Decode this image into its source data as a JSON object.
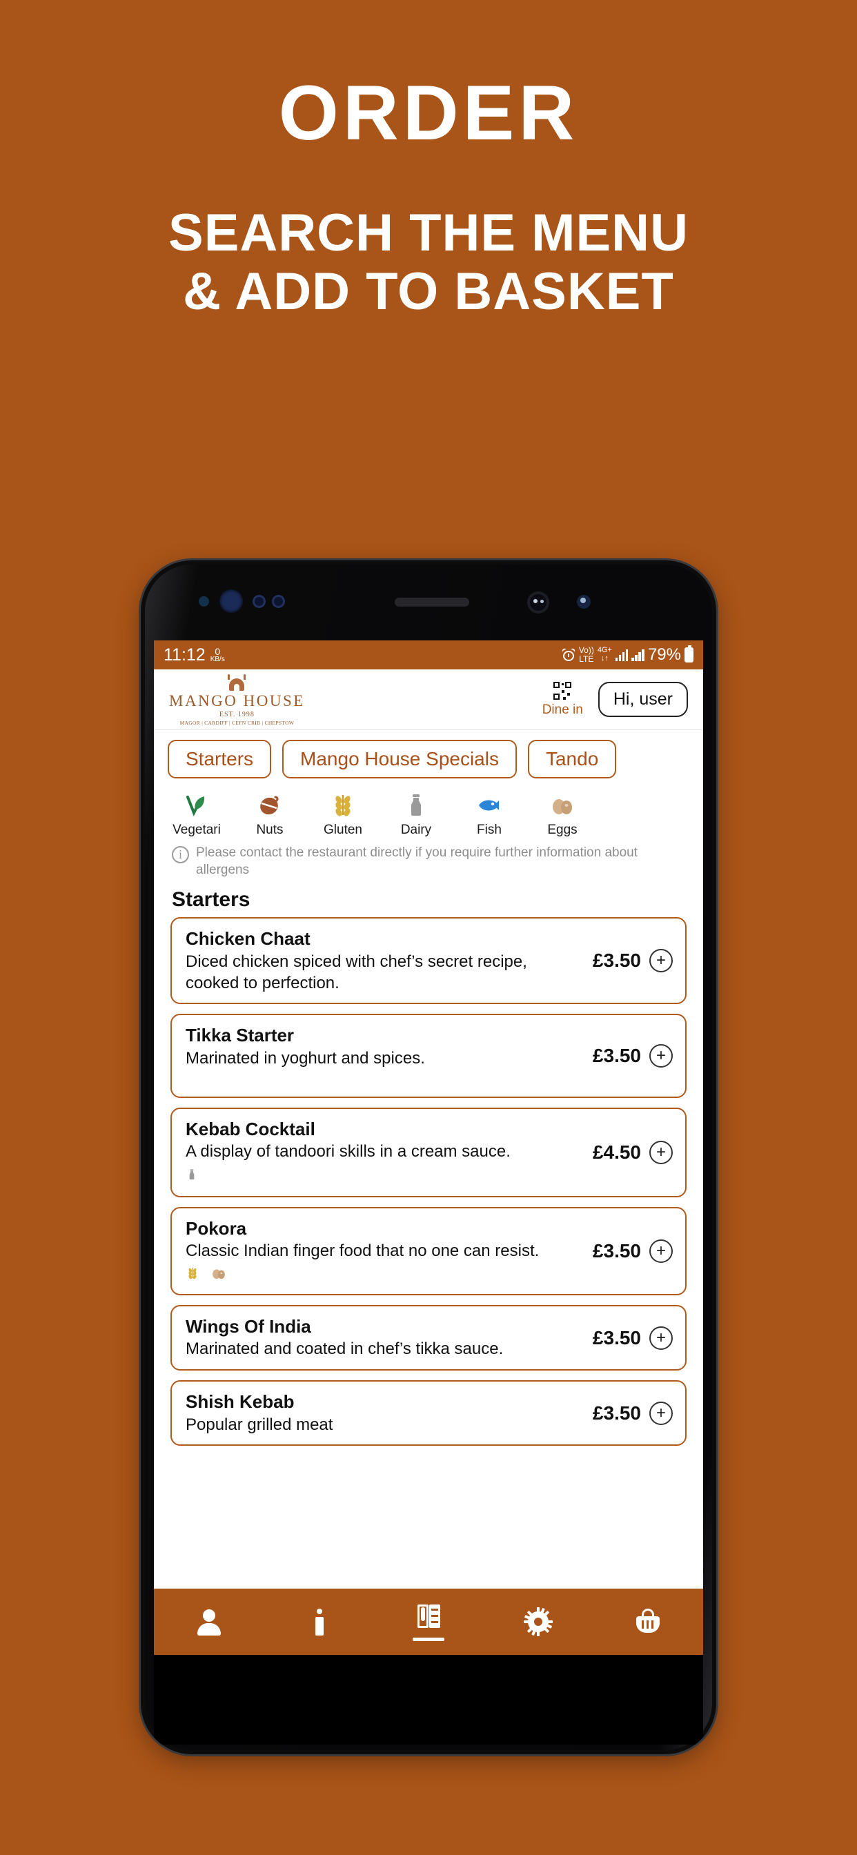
{
  "promo": {
    "headline": "ORDER",
    "subheadline_line1": "SEARCH THE MENU",
    "subheadline_line2": "& ADD TO BASKET",
    "background_color": "#A95418"
  },
  "status_bar": {
    "time": "11:12",
    "data_rate_value": "0",
    "data_rate_unit": "KB/s",
    "alarm_icon": "alarm-icon",
    "volte_top": "Vo))",
    "volte_bottom": "LTE",
    "network_top": "4G+",
    "network_bottom": "↓↑",
    "battery_percent": "79%"
  },
  "app_header": {
    "logo_name": "MANGO HOUSE",
    "logo_est": "EST. 1998",
    "logo_locations": "MAGOR | CARDIFF | CEFN CRIB | CHEPSTOW",
    "qr_icon": "qr-code-icon",
    "dine_in_label": "Dine in",
    "user_button_label": "Hi, user"
  },
  "category_tabs": [
    {
      "label": "Starters",
      "active": true
    },
    {
      "label": "Mango House Specials",
      "active": false
    },
    {
      "label": "Tando",
      "active": false
    }
  ],
  "allergen_key": [
    {
      "label": "Vegetari",
      "icon": "vegetarian-icon",
      "glyph": "🌱",
      "color": "#1F7A3D"
    },
    {
      "label": "Nuts",
      "icon": "nuts-icon",
      "glyph": "🌰",
      "color": "#A2542E"
    },
    {
      "label": "Gluten",
      "icon": "gluten-icon",
      "glyph": "🌾",
      "color": "#C9A227"
    },
    {
      "label": "Dairy",
      "icon": "dairy-icon",
      "glyph": "🍼",
      "color": "#9A9A9A"
    },
    {
      "label": "Fish",
      "icon": "fish-icon",
      "glyph": "🐟",
      "color": "#2B86D8"
    },
    {
      "label": "Eggs",
      "icon": "eggs-icon",
      "glyph": "🥚",
      "color": "#D3B089"
    }
  ],
  "allergen_note": "Please contact the restaurant directly if you require further information about allergens",
  "section": {
    "title": "Starters"
  },
  "menu_items": [
    {
      "name": "Chicken Chaat",
      "description": "Diced chicken spiced with chef’s secret recipe, cooked to perfection.",
      "price": "£3.50",
      "allergens": "",
      "add_label": "+"
    },
    {
      "name": "Tikka Starter",
      "description": "Marinated in yoghurt and spices.",
      "price": "£3.50",
      "allergens": "",
      "add_label": "+"
    },
    {
      "name": "Kebab Cocktail",
      "description": "A display of tandoori skills in a cream sauce.",
      "price": "£4.50",
      "allergens": "🍼",
      "add_label": "+"
    },
    {
      "name": "Pokora",
      "description": "Classic Indian finger food that no one can resist.",
      "price": "£3.50",
      "allergens": "🌾🥚",
      "add_label": "+"
    },
    {
      "name": "Wings Of India",
      "description": "Marinated and coated in chef’s tikka sauce.",
      "price": "£3.50",
      "allergens": "",
      "add_label": "+"
    },
    {
      "name": "Shish Kebab",
      "description": "Popular grilled meat",
      "price": "£3.50",
      "allergens": "",
      "add_label": "+"
    }
  ],
  "bottom_nav": [
    {
      "icon": "person-icon",
      "active": false
    },
    {
      "icon": "info-icon",
      "active": false
    },
    {
      "icon": "menu-icon",
      "active": true
    },
    {
      "icon": "gear-icon",
      "active": false
    },
    {
      "icon": "basket-icon",
      "active": false
    }
  ],
  "colors": {
    "brand_orange": "#A95418",
    "accent_orange": "#B05A1C"
  }
}
